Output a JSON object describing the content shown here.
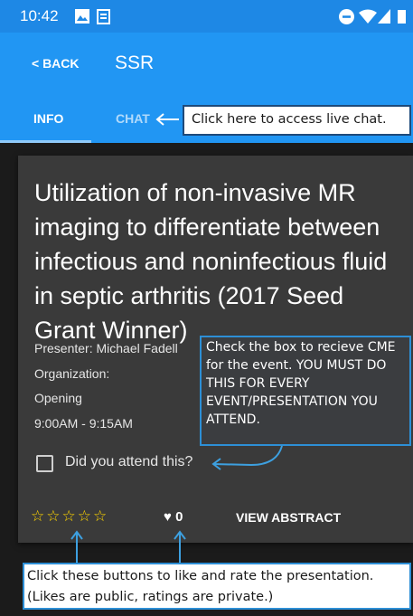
{
  "status_bar": {
    "time": "10:42",
    "icons": [
      "image-icon",
      "notes-icon",
      "do-not-disturb-icon",
      "wifi-icon",
      "signal-icon",
      "battery-icon"
    ]
  },
  "app_bar": {
    "back_label": "< BACK",
    "title": "SSR"
  },
  "tabs": [
    {
      "label": "INFO",
      "active": true
    },
    {
      "label": "CHAT",
      "active": false
    }
  ],
  "event": {
    "title": "Utilization of non-invasive MR imaging to differentiate between infectious and noninfectious fluid in septic arthritis (2017 Seed Grant Winner)",
    "presenter": "Presenter: Michael Fadell",
    "organization": "Organization:",
    "location": "Opening",
    "time": "9:00AM - 9:15AM",
    "attend_label": "Did you attend this?",
    "attended": false,
    "rating": 0,
    "rating_max": 5,
    "likes": "0",
    "view_abstract_label": "VIEW ABSTRACT"
  },
  "annotations": {
    "chat_hint": "Click here to access live chat.",
    "cme_hint": "Check the box to recieve CME for the event. YOU MUST DO THIS FOR EVERY EVENT/PRESENTATION YOU ATTEND.",
    "like_hint_line1": "Click these buttons to like and rate the presentation.",
    "like_hint_line2": "(Likes are public, ratings are private.)"
  },
  "colors": {
    "app_bar": "#2196f3",
    "status_bar": "#1e88e5",
    "card": "#3a3a3a",
    "star": "#ffd600",
    "annotation_border": "#2d8fd6"
  }
}
